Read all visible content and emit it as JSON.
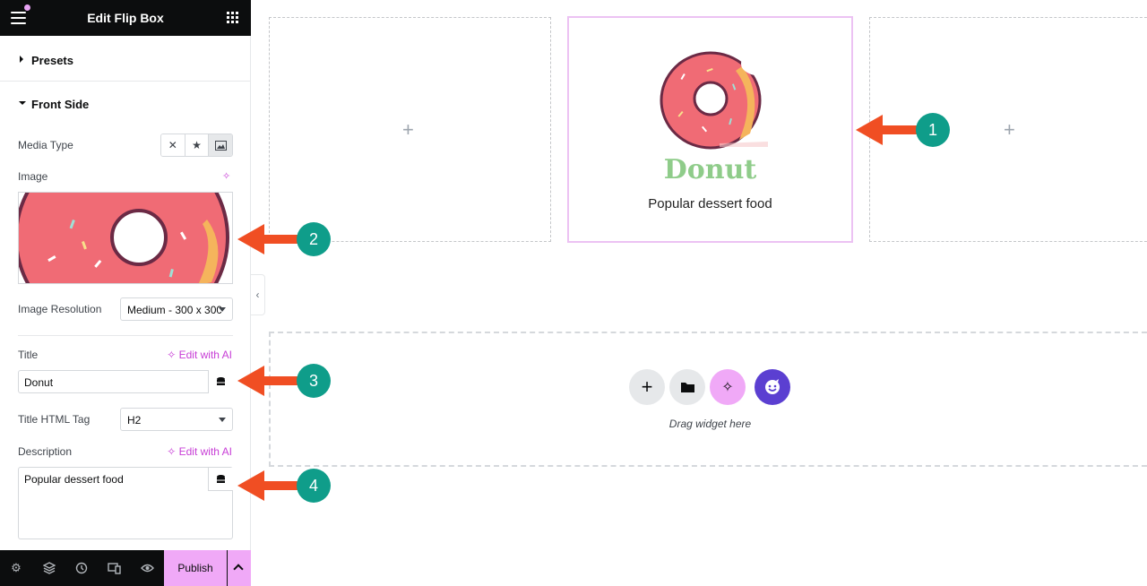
{
  "topbar": {
    "title": "Edit Flip Box"
  },
  "sections": {
    "presets": "Presets",
    "front_side": "Front Side"
  },
  "fields": {
    "media_type_label": "Media Type",
    "image_label": "Image",
    "image_resolution_label": "Image Resolution",
    "image_resolution_value": "Medium - 300 x 300",
    "title_label": "Title",
    "title_value": "Donut",
    "title_tag_label": "Title HTML Tag",
    "title_tag_value": "H2",
    "description_label": "Description",
    "description_value": "Popular dessert food",
    "edit_ai": "Edit with AI"
  },
  "bottombar": {
    "publish": "Publish"
  },
  "canvas": {
    "flip_title": "Donut",
    "flip_description": "Popular dessert food",
    "drag_hint": "Drag widget here"
  },
  "callouts": [
    "1",
    "2",
    "3",
    "4"
  ],
  "colors": {
    "accent": "#c73dd6",
    "publish": "#f0a9f7",
    "callout": "#0f9d8a",
    "arrow": "#f04e23",
    "title_green": "#8fcc8a"
  }
}
